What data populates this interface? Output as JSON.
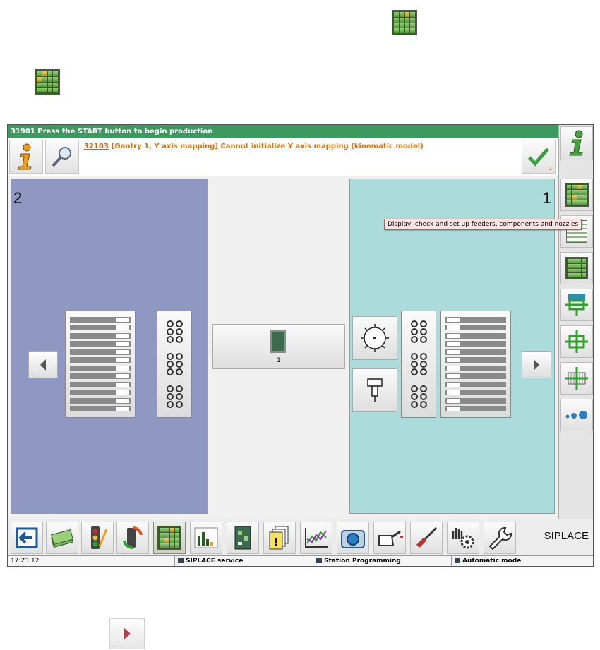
{
  "window": {
    "title": "31901 Press the START button to begin production"
  },
  "message": {
    "code": "32103",
    "text": "[Gantry 1, Y axis mapping] Cannot initialize Y axis mapping (kinematic model)",
    "ack_count": "1"
  },
  "tooltip": {
    "text": "Display, check and set up feeders, components and nozzles"
  },
  "panels": {
    "left_number": "2",
    "right_number": "1"
  },
  "center_button": {
    "label": "1"
  },
  "brand": "SIPLACE",
  "status": {
    "time": "17:23:12",
    "service": "SIPLACE service",
    "programming": "Station Programming",
    "mode": "Automatic mode"
  },
  "colors": {
    "title_bar": "#3c9a5f",
    "message_text": "#e07000",
    "left_panel": "#8e98c2",
    "right_panel": "#abdbda",
    "tooltip_bg": "#fbe4e4"
  },
  "icons": {
    "right_column": [
      "info-icon",
      "feeder-table-icon",
      "feeder-list-icon",
      "feeder-check-icon",
      "placement-head-icon",
      "component-center-icon",
      "pcb-grid-icon",
      "nozzle-dots-icon"
    ],
    "bottom_bar": [
      "exit-icon",
      "banknotes-icon",
      "traffic-light-icon",
      "cycle-icon",
      "feeder-table-icon",
      "bar-chart-icon",
      "pcb-icon",
      "warning-pages-icon",
      "line-graph-icon",
      "camera-icon",
      "oil-can-icon",
      "screwdriver-icon",
      "hand-gear-icon",
      "wrench-icon"
    ]
  }
}
